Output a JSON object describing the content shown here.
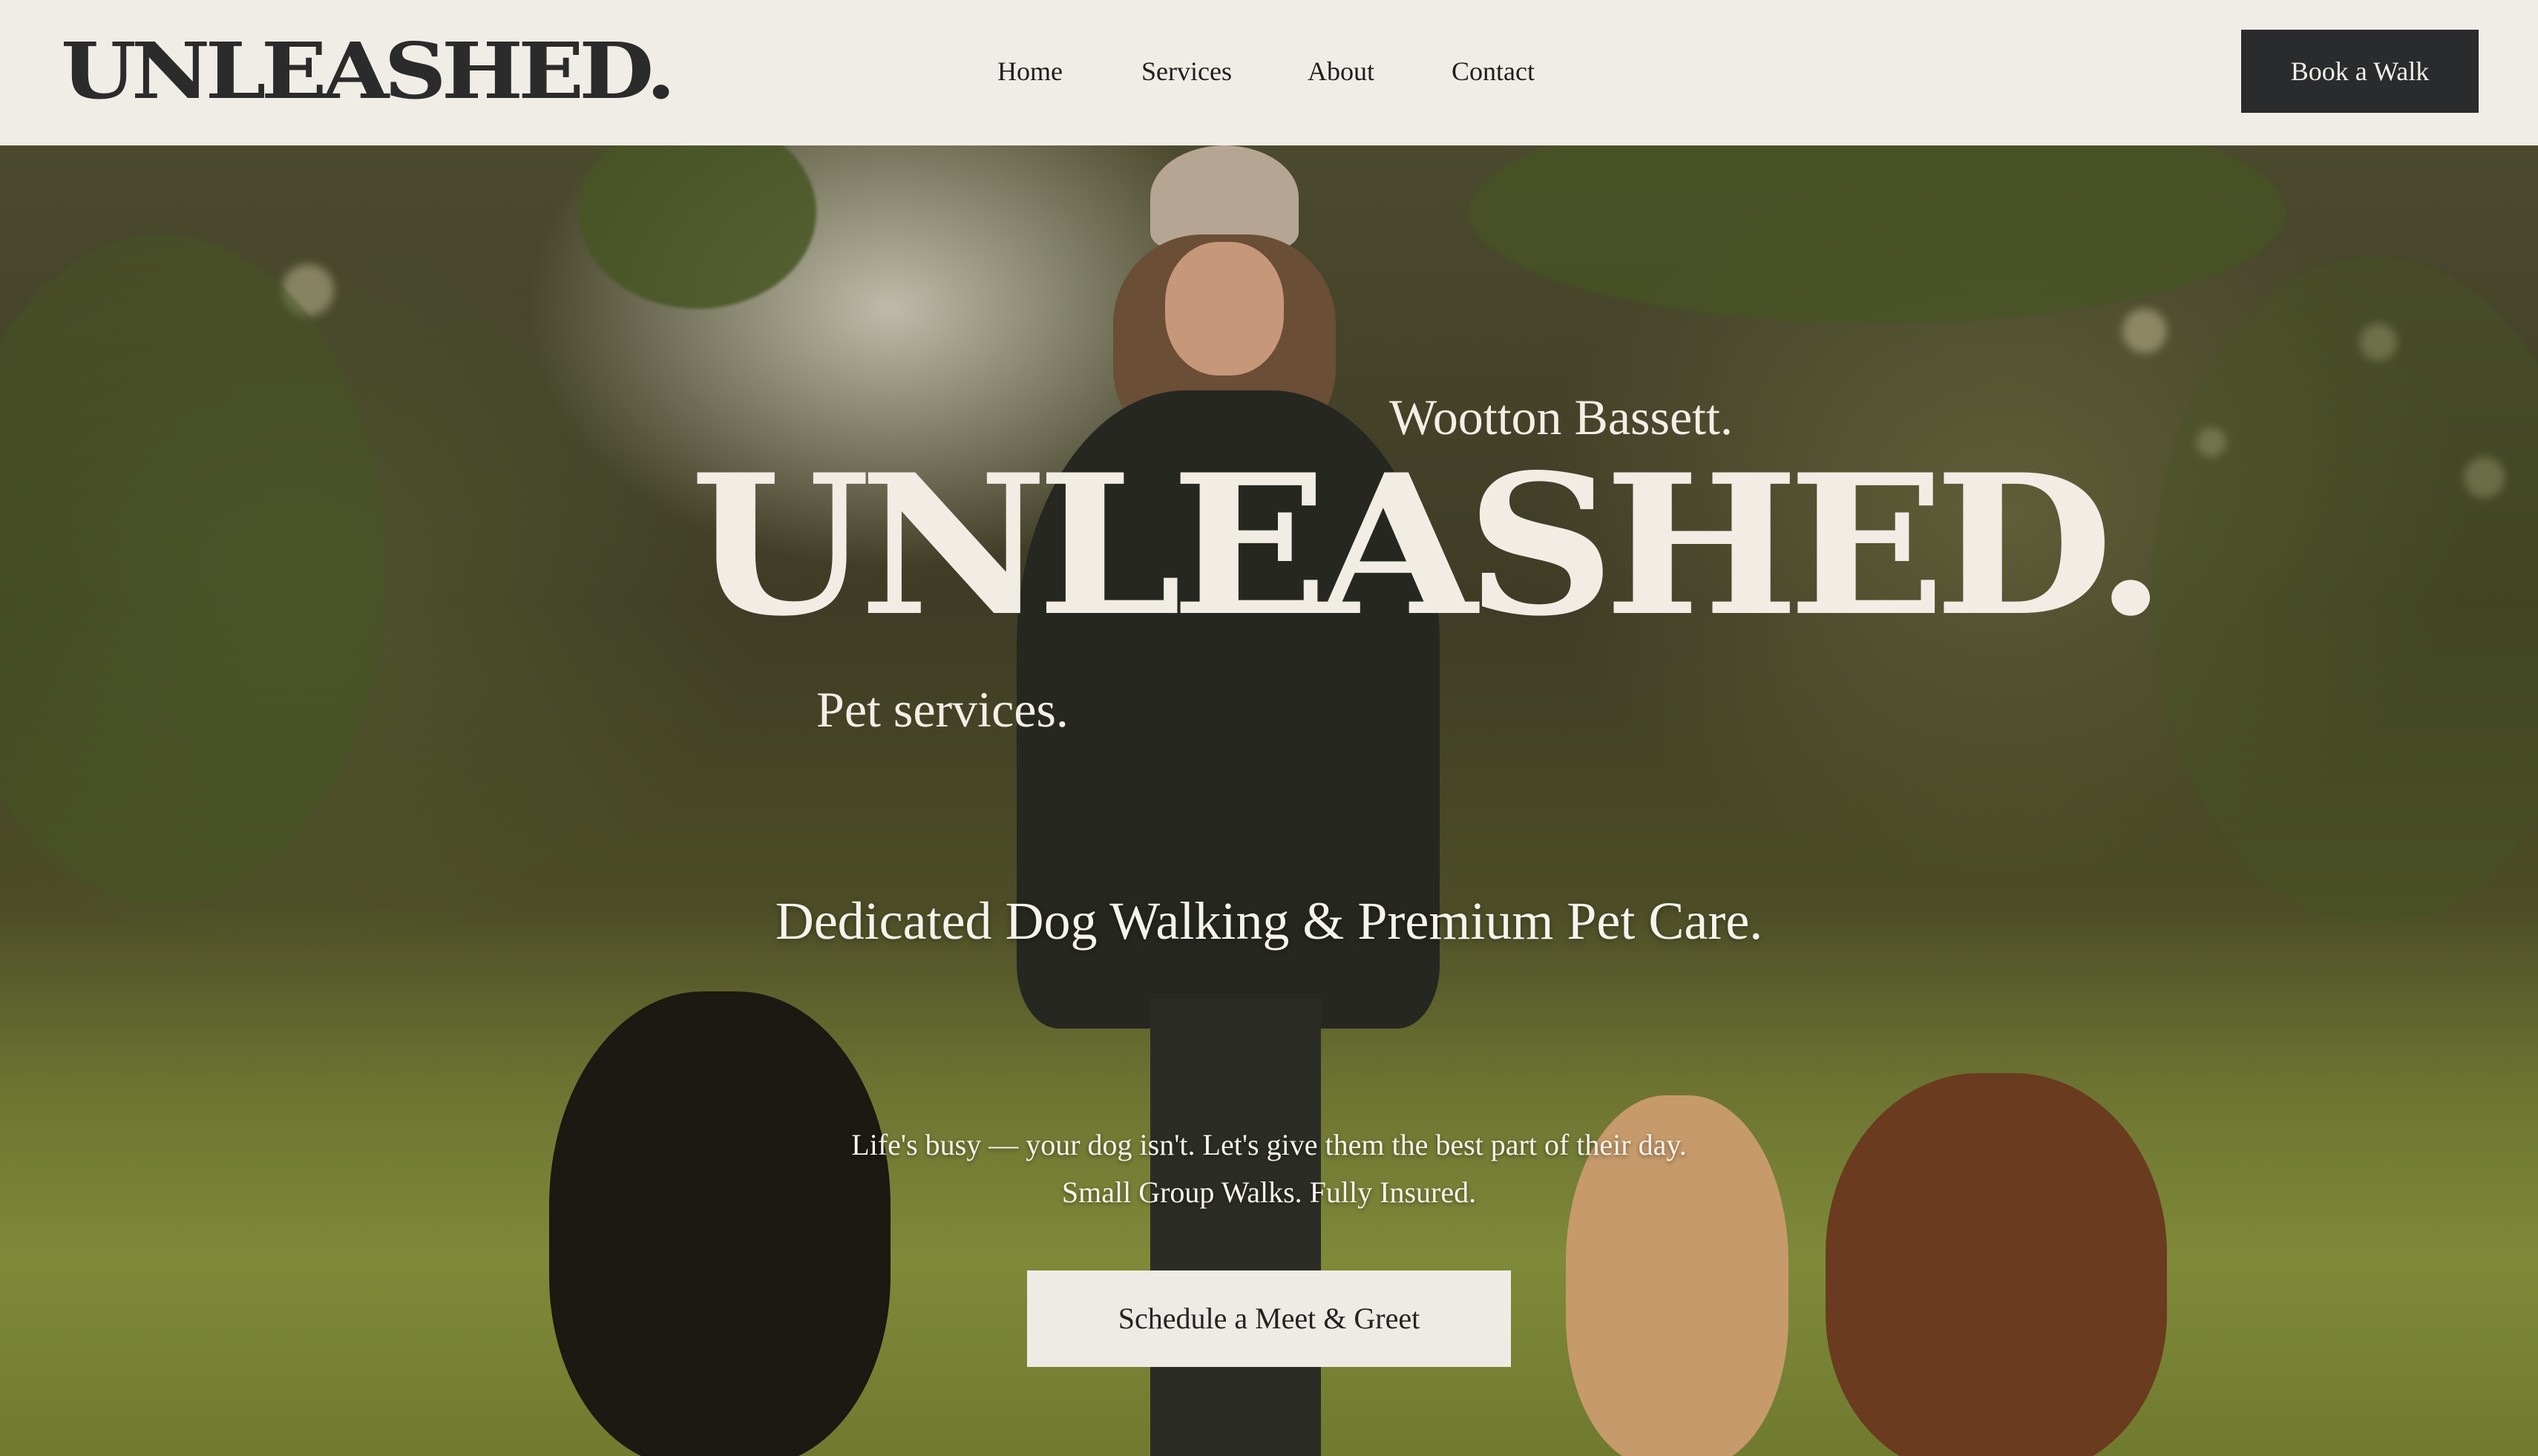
{
  "header": {
    "logo": "UNLEASHED.",
    "nav": [
      {
        "label": "Home"
      },
      {
        "label": "Services"
      },
      {
        "label": "About"
      },
      {
        "label": "Contact"
      }
    ],
    "book_button": "Book a Walk"
  },
  "hero": {
    "location": "Wootton Bassett.",
    "title": "UNLEASHED.",
    "tagline": "Pet services.",
    "headline": "Dedicated Dog Walking & Premium Pet Care.",
    "subline_1": "Life's busy — your dog isn't. Let's give them the best part of their day.",
    "subline_2": "Small Group Walks. Fully Insured.",
    "cta": "Schedule a Meet & Greet"
  },
  "colors": {
    "header_bg": "#f0ede6",
    "dark_button": "#2a2b2c",
    "light_text": "#f1ede5"
  }
}
